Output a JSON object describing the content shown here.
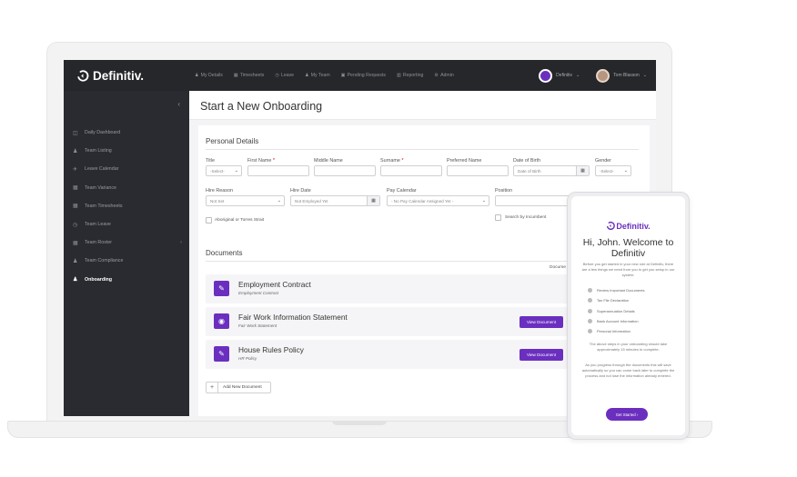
{
  "app": {
    "logo_text": "Definitiv."
  },
  "topnav": {
    "items": [
      {
        "icon": "user-icon",
        "label": "My Details"
      },
      {
        "icon": "calendar-icon",
        "label": "Timesheets"
      },
      {
        "icon": "clock-icon",
        "label": "Leave"
      },
      {
        "icon": "team-icon",
        "label": "My Team"
      },
      {
        "icon": "inbox-icon",
        "label": "Pending Requests"
      },
      {
        "icon": "chart-icon",
        "label": "Reporting"
      },
      {
        "icon": "gear-icon",
        "label": "Admin"
      }
    ],
    "org_label": "Definitiv",
    "user_label": "Tom Blasson"
  },
  "sidebar": {
    "collapse_icon": "chevron-left-icon",
    "items": [
      {
        "icon": "dashboard-icon",
        "label": "Daily Dashboard"
      },
      {
        "icon": "team-icon",
        "label": "Team Listing"
      },
      {
        "icon": "plane-icon",
        "label": "Leave Calendar"
      },
      {
        "icon": "calendar-icon",
        "label": "Team Variance"
      },
      {
        "icon": "calendar-icon",
        "label": "Team Timesheets"
      },
      {
        "icon": "clock-icon",
        "label": "Team Leave"
      },
      {
        "icon": "calendar-icon",
        "label": "Team Roster"
      },
      {
        "icon": "user-check-icon",
        "label": "Team Compliance"
      },
      {
        "icon": "user-add-icon",
        "label": "Onboarding"
      }
    ],
    "active": "Onboarding"
  },
  "page": {
    "title": "Start a New Onboarding"
  },
  "personal": {
    "title": "Personal Details",
    "fields": {
      "title_label": "Title",
      "title_value": "-Select-",
      "first_name_label": "First Name",
      "middle_name_label": "Middle Name",
      "surname_label": "Surname",
      "preferred_name_label": "Preferred Name",
      "dob_label": "Date of Birth",
      "dob_placeholder": "Date of Birth",
      "gender_label": "Gender",
      "gender_value": "-Select-",
      "hire_reason_label": "Hire Reason",
      "hire_reason_value": "Not Set",
      "hire_date_label": "Hire Date",
      "hire_date_placeholder": "Not Employed Yet",
      "pay_calendar_label": "Pay Calendar",
      "pay_calendar_value": "- No Pay Calendar Assigned Yet -",
      "position_label": "Position",
      "aboriginal_label": "Aboriginal or Torres Strait",
      "search_incumbent_label": "Search by Incumbent"
    },
    "required_mark": "*"
  },
  "documents": {
    "title": "Documents",
    "column_header": "Docume",
    "items": [
      {
        "icon": "document-sign-icon",
        "name": "Employment Contract",
        "type": "Employment Contract",
        "button": ""
      },
      {
        "icon": "eye-icon",
        "name": "Fair Work Information Statement",
        "type": "Fair Work Statement",
        "button": "View Document"
      },
      {
        "icon": "document-sign-icon",
        "name": "House Rules Policy",
        "type": "HR Policy",
        "button": "View Document"
      }
    ],
    "add_label": "Add New Document",
    "add_icon": "plus-icon"
  },
  "phone": {
    "logo_text": "Definitiv.",
    "greeting": "Hi, John. Welcome to Definitiv",
    "intro": "Before you get started in your new role at Definitiv, there are a few things we need from you to get you setup in our system:",
    "steps": [
      "Review Important Documents",
      "Tax File Declaration",
      "Superannuation Details",
      "Bank Account Information",
      "Personal Information"
    ],
    "note1": "The above steps in your onboarding should take approximately 15 minutes to complete.",
    "note2": "As you progress through the documents this will save automatically so you can come back later to complete the process and not lose the information already entered.",
    "button": "Get Started"
  },
  "colors": {
    "accent": "#6b2fbf",
    "topbar": "#26272b",
    "sidebar": "#2a2b30"
  }
}
